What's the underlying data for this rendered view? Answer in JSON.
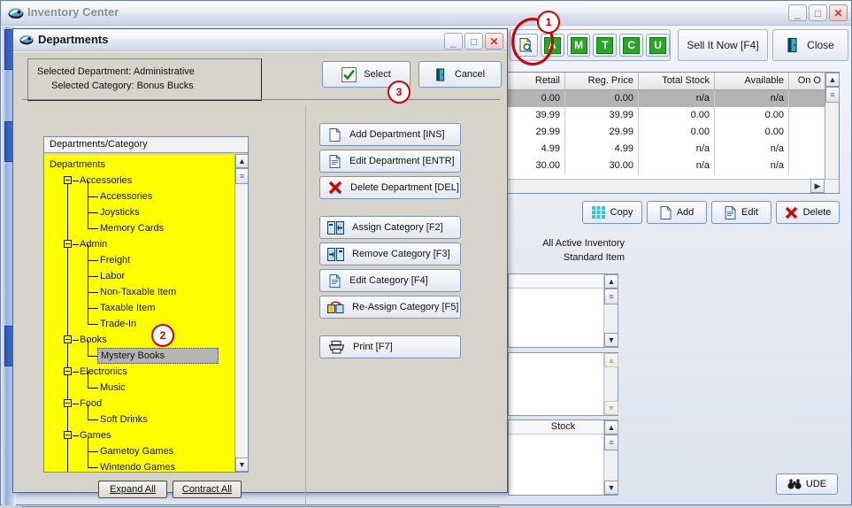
{
  "main_window": {
    "title": "Inventory Center",
    "icon": "app-logo-icon",
    "minimize_label": "_",
    "maximize_label": "□",
    "close_label": "✕"
  },
  "toolbar": {
    "preview_icon": "document-search-icon",
    "letter_buttons": [
      {
        "label": "A",
        "name": "filter-active-button"
      },
      {
        "label": "M",
        "name": "filter-matrix-button"
      },
      {
        "label": "T",
        "name": "filter-tagalong-button"
      },
      {
        "label": "C",
        "name": "filter-consignment-button"
      },
      {
        "label": "U",
        "name": "filter-used-button"
      }
    ],
    "sell_it_now_label": "Sell It Now [F4]",
    "close_label": "Close",
    "close_icon": "exit-door-icon"
  },
  "grid": {
    "columns": [
      "Retail",
      "Reg. Price",
      "Total Stock",
      "Available",
      "On O"
    ],
    "rows": [
      {
        "selected": true,
        "cells": [
          "0.00",
          "0.00",
          "n/a",
          "n/a",
          ""
        ]
      },
      {
        "selected": false,
        "cells": [
          "39.99",
          "39.99",
          "0.00",
          "0.00",
          ""
        ]
      },
      {
        "selected": false,
        "cells": [
          "29.99",
          "29.99",
          "0.00",
          "0.00",
          ""
        ]
      },
      {
        "selected": false,
        "cells": [
          "4.99",
          "4.99",
          "n/a",
          "n/a",
          ""
        ]
      },
      {
        "selected": false,
        "cells": [
          "30.00",
          "30.00",
          "n/a",
          "n/a",
          ""
        ]
      }
    ],
    "scroll_up_icon": "chevron-up-icon",
    "scroll_down_icon": "chevron-down-icon",
    "scroll_right_icon": "chevron-right-icon"
  },
  "actions": {
    "copy_label": "Copy",
    "add_label": "Add",
    "edit_label": "Edit",
    "delete_label": "Delete"
  },
  "status": {
    "line1": "All Active Inventory",
    "line2": "Standard Item"
  },
  "sub_panels": {
    "stock_column_label": "Stock"
  },
  "ude": {
    "label": "UDE",
    "icon": "binoculars-icon"
  },
  "dialog": {
    "title": "Departments",
    "icon": "app-logo-icon",
    "minimize_label": "_",
    "maximize_label": "□",
    "close_label": "✕",
    "selection": {
      "department_line": "Selected Department: Administrative",
      "category_line": "Selected Category: Bonus Bucks"
    },
    "select_label": "Select",
    "select_icon": "checkmark-icon",
    "cancel_label": "Cancel",
    "cancel_icon": "exit-door-icon",
    "buttons": [
      {
        "label": "Add Department [INS]",
        "icon": "new-document-icon",
        "name": "add-department-button"
      },
      {
        "label": "Edit Department [ENTR]",
        "icon": "edit-document-icon",
        "name": "edit-department-button"
      },
      {
        "label": "Delete Department [DEL]",
        "icon": "red-x-icon",
        "name": "delete-department-button"
      },
      {
        "label": "Assign Category [F2]",
        "icon": "assign-arrow-icon",
        "name": "assign-category-button"
      },
      {
        "label": "Remove Category [F3]",
        "icon": "remove-arrow-icon",
        "name": "remove-category-button"
      },
      {
        "label": "Edit Category [F4]",
        "icon": "edit-document-icon",
        "name": "edit-category-button"
      },
      {
        "label": "Re-Assign Category [F5]",
        "icon": "reassign-boxes-icon",
        "name": "reassign-category-button"
      },
      {
        "label": "Print [F7]",
        "icon": "printer-icon",
        "name": "print-button"
      }
    ],
    "tree": {
      "header": "Departments/Category",
      "nodes": [
        {
          "label": "Departments",
          "level": 0,
          "expandable": false,
          "selected": false
        },
        {
          "label": "Accessories",
          "level": 1,
          "expandable": true,
          "selected": false
        },
        {
          "label": "Accessories",
          "level": 2,
          "expandable": false,
          "selected": false
        },
        {
          "label": "Joysticks",
          "level": 2,
          "expandable": false,
          "selected": false
        },
        {
          "label": "Memory Cards",
          "level": 2,
          "expandable": false,
          "selected": false
        },
        {
          "label": "Admin",
          "level": 1,
          "expandable": true,
          "selected": false
        },
        {
          "label": "Freight",
          "level": 2,
          "expandable": false,
          "selected": false
        },
        {
          "label": "Labor",
          "level": 2,
          "expandable": false,
          "selected": false
        },
        {
          "label": "Non-Taxable Item",
          "level": 2,
          "expandable": false,
          "selected": false
        },
        {
          "label": "Taxable Item",
          "level": 2,
          "expandable": false,
          "selected": false
        },
        {
          "label": "Trade-In",
          "level": 2,
          "expandable": false,
          "selected": false
        },
        {
          "label": "Books",
          "level": 1,
          "expandable": true,
          "selected": false
        },
        {
          "label": "Mystery Books",
          "level": 2,
          "expandable": false,
          "selected": true
        },
        {
          "label": "Electronics",
          "level": 1,
          "expandable": true,
          "selected": false
        },
        {
          "label": "Music",
          "level": 2,
          "expandable": false,
          "selected": false
        },
        {
          "label": "Food",
          "level": 1,
          "expandable": true,
          "selected": false
        },
        {
          "label": "Soft Drinks",
          "level": 2,
          "expandable": false,
          "selected": false
        },
        {
          "label": "Games",
          "level": 1,
          "expandable": true,
          "selected": false
        },
        {
          "label": "Gametoy Games",
          "level": 2,
          "expandable": false,
          "selected": false
        },
        {
          "label": "Wintendo Games",
          "level": 2,
          "expandable": false,
          "selected": false
        }
      ]
    },
    "expand_all_label": "Expand All",
    "contract_all_label": "Contract All"
  },
  "annotations": [
    {
      "number": "1",
      "target": "toolbar-preview-button"
    },
    {
      "number": "2",
      "target": "tree-node-mystery-books"
    },
    {
      "number": "3",
      "target": "select-button"
    }
  ],
  "colors": {
    "tree_background": "#ffff00",
    "annotation": "#d40000",
    "letter_button_green": "#2aa42a",
    "selection_gray": "#b4b4b4"
  }
}
